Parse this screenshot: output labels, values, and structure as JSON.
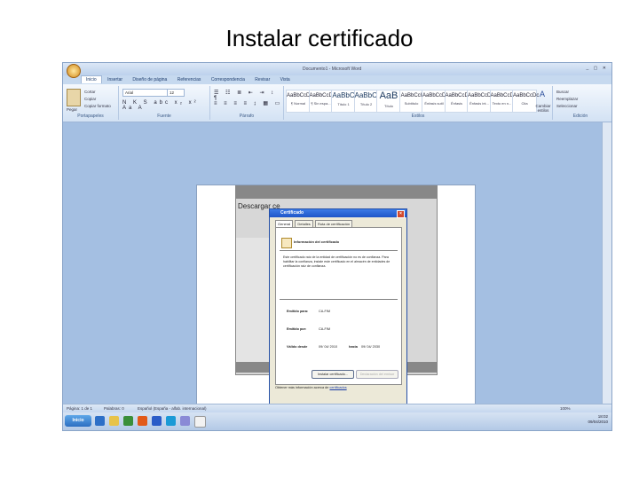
{
  "slide": {
    "title": "Instalar certificado"
  },
  "word": {
    "window_title": "Documento1 - Microsoft Word",
    "tabs": [
      "Inicio",
      "Insertar",
      "Diseño de página",
      "Referencias",
      "Correspondencia",
      "Revisar",
      "Vista"
    ],
    "clipboard": {
      "paste": "Pegar",
      "cut": "Cortar",
      "copy": "Copiar",
      "format_painter": "Copiar formato",
      "label": "Portapapeles"
    },
    "font": {
      "name": "Arial",
      "size": "12",
      "label": "Fuente"
    },
    "paragraph": {
      "label": "Párrafo"
    },
    "styles": {
      "label": "Estilos",
      "items": [
        {
          "sample": "AaBbCcDc",
          "name": "¶ Normal",
          "size": "small"
        },
        {
          "sample": "AaBbCcDc",
          "name": "¶ Sin espa...",
          "size": "small"
        },
        {
          "sample": "AaBbC",
          "name": "Título 1",
          "size": "mid"
        },
        {
          "sample": "AaBbCc",
          "name": "Título 2",
          "size": "mid"
        },
        {
          "sample": "AaB",
          "name": "Título",
          "size": "big"
        },
        {
          "sample": "AaBbCcI",
          "name": "Subtítulo",
          "size": "small"
        },
        {
          "sample": "AaBbCcDc",
          "name": "Énfasis sutil",
          "size": "small"
        },
        {
          "sample": "AaBbCcDc",
          "name": "Énfasis",
          "size": "small"
        },
        {
          "sample": "AaBbCcDc",
          "name": "Énfasis int...",
          "size": "small"
        },
        {
          "sample": "AaBbCcDc",
          "name": "Texto en n...",
          "size": "small"
        },
        {
          "sample": "AaBbCcDc",
          "name": "Cita",
          "size": "small"
        }
      ],
      "change": "Cambiar estilos"
    },
    "editing": {
      "find": "Buscar",
      "replace": "Reemplazar",
      "select": "Seleccionar",
      "label": "Edición"
    },
    "status": {
      "page": "Página: 1 de 1",
      "words": "Palabras: 0",
      "language": "Español (España - alfab. internacional)",
      "zoom": "100%"
    }
  },
  "inner": {
    "heading": "Descargar ce"
  },
  "dialog": {
    "title": "Certificado",
    "tabs": [
      "General",
      "Detalles",
      "Ruta de certificación"
    ],
    "info_title": "Información del certificado",
    "description": "Este certificado raíz de la entidad de certificación no es de confianza. Para habilitar la confianza, instale este certificado en el almacén de entidades de certificación raíz de confianza.",
    "issued_to_label": "Emitido para:",
    "issued_to_value": "CA-FIM",
    "issued_by_label": "Emitido por:",
    "issued_by_value": "CA-FIM",
    "valid_label": "Válido desde",
    "valid_from": "09/ 04/ 2010",
    "valid_to_label": "hasta",
    "valid_to": "09/ 04/ 2030",
    "install_button": "Instalar certificado...",
    "issuer_statement_button": "Declaración del emisor",
    "more_info_prefix": "Obtener más información acerca de",
    "more_info_link": "certificados",
    "accept_button": "Aceptar"
  },
  "taskbar": {
    "start": "Inicio",
    "time": "18:02",
    "date": "09/04/2010"
  }
}
